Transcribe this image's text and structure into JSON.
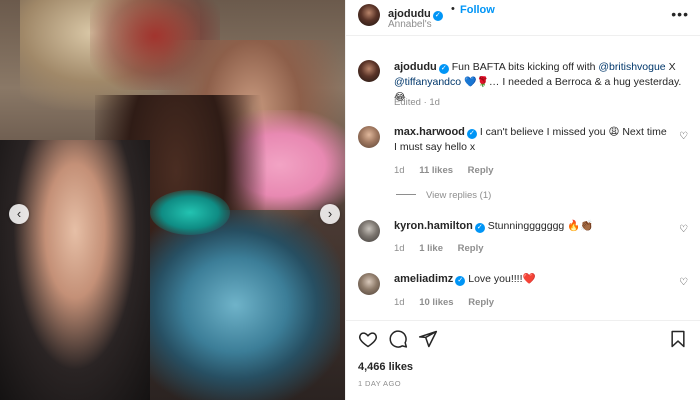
{
  "post": {
    "author": "ajodudu",
    "follow_label": "Follow",
    "separator": "•",
    "location": "Annabel's",
    "more": "•••",
    "caption": {
      "username": "ajodudu",
      "text_1": "Fun BAFTA bits kicking off with",
      "mention_1": "@britishvogue",
      "text_2": "X",
      "mention_2": "@tiffanyandco",
      "emoji_1": "💙🌹",
      "text_3": "… I needed a Berroca & a hug yesterday.",
      "emoji_2": "😂"
    },
    "edited": "Edited · 1d",
    "likes": "4,466 likes",
    "time_ago": "1 DAY AGO"
  },
  "comments": [
    {
      "username": "max.harwood",
      "text": "I can't believe I missed you 😩 Next time I must say hello x",
      "age": "1d",
      "likes": "11 likes",
      "reply": "Reply"
    },
    {
      "username": "kyron.hamilton",
      "text": "Stunninggggggg 🔥👏🏾",
      "age": "1d",
      "likes": "1 like",
      "reply": "Reply"
    },
    {
      "username": "ameliadimz",
      "text": "Love you!!!!❤️",
      "age": "1d",
      "likes": "10 likes",
      "reply": "Reply"
    }
  ],
  "view_replies": "View replies (1)",
  "icons": {
    "prev": "‹",
    "next": "›",
    "heart": "♡",
    "verified": "✓"
  }
}
